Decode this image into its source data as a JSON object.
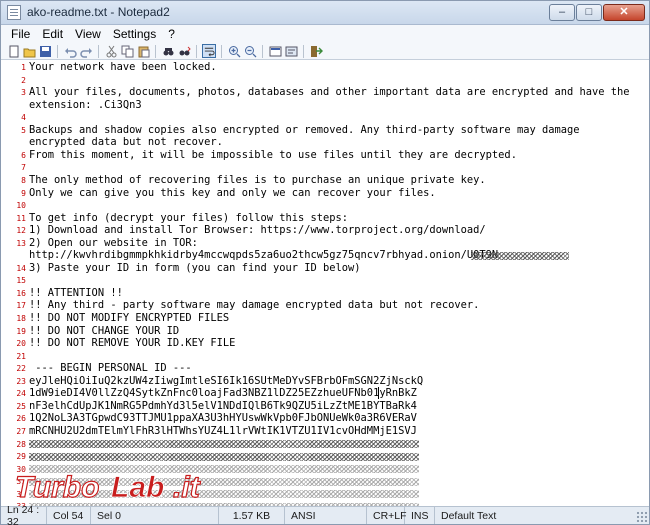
{
  "window": {
    "title": "ako-readme.txt - Notepad2"
  },
  "window_buttons": {
    "minimize": "‒",
    "maximize": "□",
    "close": "✕"
  },
  "menu": [
    {
      "label": "File",
      "hotkey": "F"
    },
    {
      "label": "Edit",
      "hotkey": "E"
    },
    {
      "label": "View",
      "hotkey": "V"
    },
    {
      "label": "Settings",
      "hotkey": "S"
    },
    {
      "label": "?",
      "hotkey": "?"
    }
  ],
  "toolbar": [
    {
      "icon": "new-file-icon"
    },
    {
      "icon": "open-folder-icon"
    },
    {
      "icon": "save-icon"
    },
    {
      "sep": true
    },
    {
      "icon": "undo-icon"
    },
    {
      "icon": "redo-icon"
    },
    {
      "sep": true
    },
    {
      "icon": "cut-icon"
    },
    {
      "icon": "copy-icon"
    },
    {
      "icon": "paste-icon"
    },
    {
      "sep": true
    },
    {
      "icon": "find-icon"
    },
    {
      "icon": "replace-icon"
    },
    {
      "sep": true
    },
    {
      "icon": "word-wrap-icon",
      "active": true
    },
    {
      "sep": true
    },
    {
      "icon": "zoom-in-icon"
    },
    {
      "icon": "zoom-out-icon"
    },
    {
      "sep": true
    },
    {
      "icon": "scheme-icon"
    },
    {
      "icon": "settings-icon"
    },
    {
      "sep": true
    },
    {
      "icon": "exit-icon"
    }
  ],
  "editor": {
    "lines": [
      {
        "n": "1",
        "text": "Your network have been locked."
      },
      {
        "n": "2",
        "text": ""
      },
      {
        "n": "3",
        "text": "All your files, documents, photos, databases and other important data are encrypted and have the"
      },
      {
        "n": "",
        "text": "extension: .Ci3Qn3"
      },
      {
        "n": "4",
        "text": ""
      },
      {
        "n": "5",
        "text": "Backups and shadow copies also encrypted or removed. Any third-party software may damage"
      },
      {
        "n": "",
        "text": "encrypted data but not recover."
      },
      {
        "n": "6",
        "text": "From this moment, it will be impossible to use files until they are decrypted."
      },
      {
        "n": "7",
        "text": ""
      },
      {
        "n": "8",
        "text": "The only method of recovering files is to purchase an unique private key."
      },
      {
        "n": "9",
        "text": "Only we can give you this key and only we can recover your files."
      },
      {
        "n": "10",
        "text": ""
      },
      {
        "n": "11",
        "text": "To get info (decrypt your files) follow this steps:"
      },
      {
        "n": "12",
        "text": "1) Download and install Tor Browser: https://www.torproject.org/download/"
      },
      {
        "n": "13",
        "text": "2) Open our website in TOR:"
      },
      {
        "n": "",
        "text": "http://kwvhrdibgmmpkhkidrby4mccwqpds5za6uo2thcw5gz75qncv7rbhyad.onion/U0T9N"
      },
      {
        "n": "14",
        "text": "3) Paste your ID in form (you can find your ID below)"
      },
      {
        "n": "15",
        "text": ""
      },
      {
        "n": "16",
        "text": "!! ATTENTION !!"
      },
      {
        "n": "17",
        "text": "!! Any third - party software may damage encrypted data but not recover."
      },
      {
        "n": "18",
        "text": "!! DO NOT MODIFY ENCRYPTED FILES"
      },
      {
        "n": "19",
        "text": "!! DO NOT CHANGE YOUR ID"
      },
      {
        "n": "20",
        "text": "!! DO NOT REMOVE YOUR ID.KEY FILE"
      },
      {
        "n": "21",
        "text": ""
      },
      {
        "n": "22",
        "text": " --- BEGIN PERSONAL ID ---"
      },
      {
        "n": "23",
        "text": "eyJleHQiOiIuQ2kzUW4zIiwgImtleSI6Ik16SUtMeDYvSFBrbOFmSGN2ZjNsckQ"
      },
      {
        "n": "24",
        "text": "1dW9ieDI4V0llZzQ4SytkZnFnc0loajFad3NBZ1lDZ25EZzhueUFNb01yRnBkZ"
      },
      {
        "n": "25",
        "text": "nF3elhCdUpJK1NmRG5PdmhYd3l5elV1NDdIQlB6Tk9QZU5iLzZtME1BYTBaRk4"
      },
      {
        "n": "26",
        "text": "1Q2NoL3A3TGpwdC93TTJMU1ppaXA3U3hHYUswWkVpb0FJbONUeWk0a3R6VERaV"
      },
      {
        "n": "27",
        "text": "mRCNHU2U2dmTElmYlFhR3lHTWhsYUZ4L1lrVWtIK1VTZU1IV1cvOHdMMjE1SVJ"
      },
      {
        "n": "28",
        "text": ""
      },
      {
        "n": "29",
        "text": ""
      },
      {
        "n": "30",
        "text": ""
      },
      {
        "n": "31",
        "text": ""
      },
      {
        "n": "32",
        "text": ""
      },
      {
        "n": "33",
        "text": ""
      },
      {
        "n": "34",
        "text": "ID"
      }
    ]
  },
  "watermark": {
    "text_a": "Turbo",
    "text_b": "Lab",
    "text_c": ".it"
  },
  "statusbar": {
    "position": "Ln 24 : 32",
    "column": "Col 54",
    "selection": "Sel 0",
    "size": "1.57 KB",
    "encoding": "ANSI",
    "line_endings": "CR+LF",
    "insert_mode": "INS",
    "scheme": "Default Text"
  }
}
